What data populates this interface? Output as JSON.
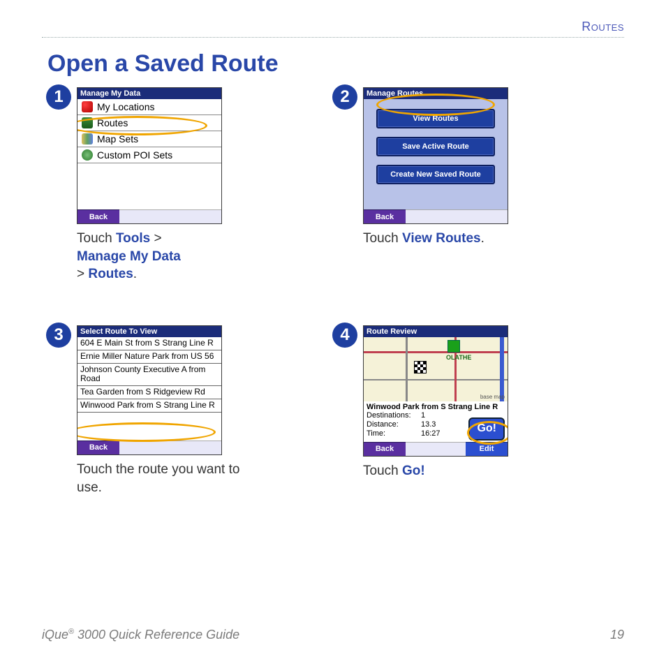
{
  "header": {
    "section": "Routes"
  },
  "title": "Open a Saved Route",
  "steps": [
    {
      "num": "1",
      "screen": {
        "title": "Manage My Data",
        "rows": [
          {
            "icon": "heart",
            "label": "My Locations"
          },
          {
            "icon": "route",
            "label": "Routes"
          },
          {
            "icon": "map",
            "label": "Map Sets"
          },
          {
            "icon": "poi",
            "label": "Custom POI Sets"
          }
        ],
        "back": "Back"
      },
      "caption_pre": "Touch ",
      "caption_kw1": "Tools",
      "caption_mid1": " > ",
      "caption_kw2": "Manage My Data",
      "caption_mid2": " > ",
      "caption_kw3": "Routes",
      "caption_post": "."
    },
    {
      "num": "2",
      "screen": {
        "title": "Manage Routes",
        "buttons": [
          "View Routes",
          "Save Active Route",
          "Create New Saved Route"
        ],
        "back": "Back"
      },
      "caption_pre": "Touch ",
      "caption_kw1": "View Routes",
      "caption_post": "."
    },
    {
      "num": "3",
      "screen": {
        "title": "Select Route To View",
        "rows": [
          "604 E Main St from S Strang Line R",
          "Ernie Miller Nature Park from US 56",
          "Johnson County Executive A from Road",
          "Tea Garden from S Ridgeview Rd",
          "Winwood Park from S Strang Line R"
        ],
        "back": "Back"
      },
      "caption": "Touch the route you want to use."
    },
    {
      "num": "4",
      "screen": {
        "title": "Route Review",
        "place": "OLATHE",
        "route_name": "Winwood Park from S Strang Line R",
        "dest_label": "Destinations:",
        "dest_val": "1",
        "dist_label": "Distance:",
        "dist_val": "13.3",
        "time_label": "Time:",
        "time_val": "16:27",
        "go": "Go!",
        "basemap": "base map",
        "back": "Back",
        "edit": "Edit"
      },
      "caption_pre": "Touch ",
      "caption_kw1": "Go!"
    }
  ],
  "footer": {
    "product_a": "iQue",
    "product_b": " 3000 Quick Reference Guide",
    "page": "19"
  }
}
